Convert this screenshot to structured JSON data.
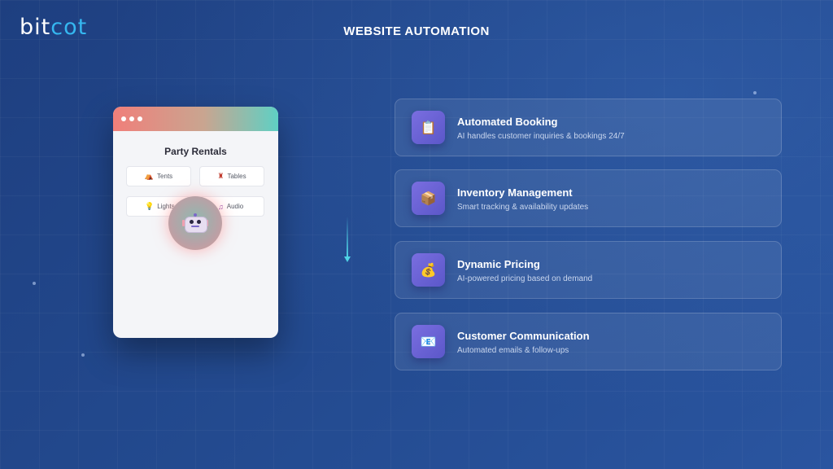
{
  "header": {
    "logo_part1": "bit",
    "logo_part2": "cot",
    "title": "WEBSITE AUTOMATION"
  },
  "colors": {
    "background": "#234a8f",
    "logo_accent": "#35b7f0",
    "card_icon": "#6a63d5",
    "arrow": "#4fd3e6"
  },
  "browser": {
    "title": "Party Rentals",
    "chips": [
      {
        "icon": "tent-icon",
        "glyph": "⛺",
        "label": "Tents"
      },
      {
        "icon": "table-icon",
        "glyph": "♜",
        "label": "Tables"
      },
      {
        "icon": "light-bulb-icon",
        "glyph": "💡",
        "label": "Lights"
      },
      {
        "icon": "music-note-icon",
        "glyph": "♫",
        "label": "Audio"
      }
    ],
    "assistant_icon": "robot-icon"
  },
  "features": [
    {
      "icon": "clipboard-icon",
      "glyph": "📋",
      "title": "Automated Booking",
      "desc": "AI handles customer inquiries & bookings 24/7"
    },
    {
      "icon": "box-icon",
      "glyph": "📦",
      "title": "Inventory Management",
      "desc": "Smart tracking & availability updates"
    },
    {
      "icon": "money-bag-icon",
      "glyph": "💰",
      "title": "Dynamic Pricing",
      "desc": "AI-powered pricing based on demand"
    },
    {
      "icon": "email-icon",
      "glyph": "📧",
      "title": "Customer Communication",
      "desc": "Automated emails & follow-ups"
    }
  ]
}
